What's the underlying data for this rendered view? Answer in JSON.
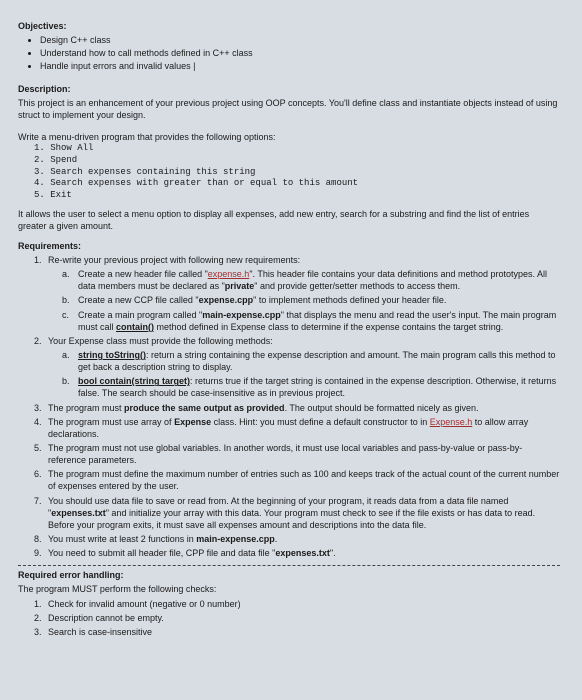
{
  "objectives": {
    "heading": "Objectives:",
    "items": [
      "Design C++ class",
      "Understand how to call methods defined in C++ class",
      "Handle input errors and invalid values |"
    ]
  },
  "description": {
    "heading": "Description:",
    "body": "This project is an enhancement of your previous project using OOP concepts. You'll define class and instantiate objects instead of using struct to implement your design."
  },
  "menu": {
    "intro": "Write a menu-driven program that provides the following options:",
    "options": [
      "1. Show All",
      "2. Spend",
      "3. Search expenses containing this string",
      "4. Search expenses with greater than or equal to this amount",
      "5. Exit"
    ],
    "after": "It allows the user to select a menu option to display all expenses, add new entry, search for a substring and find the list of entries greater a given amount."
  },
  "requirements": {
    "heading": "Requirements:",
    "items": [
      {
        "num": "1.",
        "text": "Re-write your previous project with following new requirements:",
        "sub": [
          {
            "let": "a.",
            "parts": [
              {
                "t": "Create a new header file called \""
              },
              {
                "t": "expense.h",
                "class": "underline red"
              },
              {
                "t": "\". This header file contains your data definitions and method prototypes. All data members must be declared as \""
              },
              {
                "t": "private",
                "class": "bold"
              },
              {
                "t": "\" and provide getter/setter methods to access them."
              }
            ]
          },
          {
            "let": "b.",
            "parts": [
              {
                "t": "Create a new CCP file called \""
              },
              {
                "t": "expense.cpp",
                "class": "bold"
              },
              {
                "t": "\" to implement methods defined your header file."
              }
            ]
          },
          {
            "let": "c.",
            "parts": [
              {
                "t": "Create a main program called \""
              },
              {
                "t": "main-expense.cpp",
                "class": "bold"
              },
              {
                "t": "\" that displays the menu and read the user's input. The main program must call "
              },
              {
                "t": "contain()",
                "class": "bold underline"
              },
              {
                "t": " method defined in Expense class to determine if the expense contains the target string."
              }
            ]
          }
        ]
      },
      {
        "num": "2.",
        "text": "Your Expense class must provide the following methods:",
        "sub": [
          {
            "let": "a.",
            "parts": [
              {
                "t": "string toString()",
                "class": "bold underline"
              },
              {
                "t": ": return a string containing the expense description and amount. The main program calls this method to get back a description string to display."
              }
            ]
          },
          {
            "let": "b.",
            "parts": [
              {
                "t": "bool contain(string target)",
                "class": "bold underline"
              },
              {
                "t": ": returns true if the target string is contained in the expense description. Otherwise, it returns false. The search should be case-insensitive as in previous project."
              }
            ]
          }
        ]
      },
      {
        "num": "3.",
        "parts": [
          {
            "t": "The program must "
          },
          {
            "t": "produce the same output as provided",
            "class": "bold"
          },
          {
            "t": ". The output should be formatted nicely as given."
          }
        ]
      },
      {
        "num": "4.",
        "parts": [
          {
            "t": "The program must use array of "
          },
          {
            "t": "Expense",
            "class": "bold"
          },
          {
            "t": " class. Hint: you must define a default constructor to in "
          },
          {
            "t": "Expense.h",
            "class": "underline red"
          },
          {
            "t": " to allow array declarations."
          }
        ]
      },
      {
        "num": "5.",
        "parts": [
          {
            "t": "The program must not use global variables. In another words, it must use local variables and pass-by-value or pass-by-reference parameters."
          }
        ]
      },
      {
        "num": "6.",
        "parts": [
          {
            "t": "The program must define the maximum number of entries such as 100 and keeps track of the actual count of the current number of expenses entered by the user."
          }
        ]
      },
      {
        "num": "7.",
        "parts": [
          {
            "t": "You should use data file to save or read from. At the beginning of your program, it reads data from a data file named \""
          },
          {
            "t": "expenses.txt",
            "class": "bold"
          },
          {
            "t": "\" and initialize your array with this data. Your program must check to see if the file exists or has data to read. Before your program exits, it must save all expenses amount and descriptions into the data file."
          }
        ]
      },
      {
        "num": "8.",
        "parts": [
          {
            "t": "You must write at least 2 functions in "
          },
          {
            "t": "main-expense.cpp",
            "class": "bold"
          },
          {
            "t": "."
          }
        ]
      },
      {
        "num": "9.",
        "parts": [
          {
            "t": "You need to submit all header file, CPP file and data file \""
          },
          {
            "t": "expenses.txt",
            "class": "bold"
          },
          {
            "t": "\"."
          }
        ]
      }
    ]
  },
  "error_handling": {
    "heading": "Required error handling:",
    "intro": "The program MUST perform the following checks:",
    "items": [
      "Check for invalid amount (negative or 0 number)",
      "Description cannot be empty.",
      "Search is case-insensitive"
    ]
  }
}
